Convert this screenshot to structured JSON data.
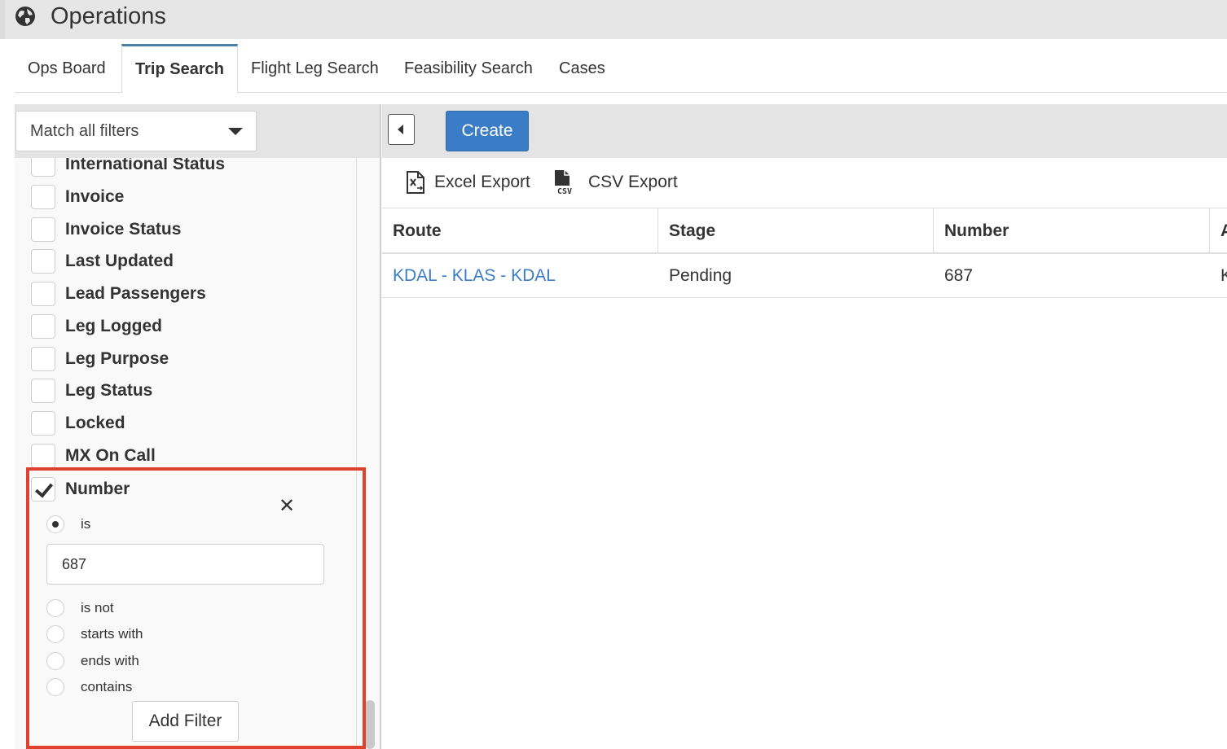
{
  "app": {
    "title": "Operations"
  },
  "tabs": [
    {
      "label": "Ops Board",
      "active": false
    },
    {
      "label": "Trip Search",
      "active": true
    },
    {
      "label": "Flight Leg Search",
      "active": false
    },
    {
      "label": "Feasibility Search",
      "active": false
    },
    {
      "label": "Cases",
      "active": false
    }
  ],
  "sidebar": {
    "match_select": "Match all filters",
    "filters": [
      "International Status",
      "Invoice",
      "Invoice Status",
      "Last Updated",
      "Lead Passengers",
      "Leg Logged",
      "Leg Purpose",
      "Leg Status",
      "Locked",
      "MX On Call"
    ],
    "active_filter": {
      "label": "Number",
      "checked": true,
      "selected_option": "is",
      "value": "687",
      "options": [
        "is",
        "is not",
        "starts with",
        "ends with",
        "contains"
      ],
      "add_button": "Add Filter"
    }
  },
  "toolbar": {
    "create_label": "Create",
    "excel_export": "Excel Export",
    "csv_export": "CSV Export"
  },
  "table": {
    "columns": [
      "Route",
      "Stage",
      "Number",
      "A"
    ],
    "rows": [
      [
        "KDAL - KLAS - KDAL",
        "Pending",
        "687",
        "K"
      ]
    ]
  },
  "colors": {
    "accent": "#3a7cc6",
    "tab_active_border": "#4a7fa5",
    "highlight": "#e0412f"
  }
}
